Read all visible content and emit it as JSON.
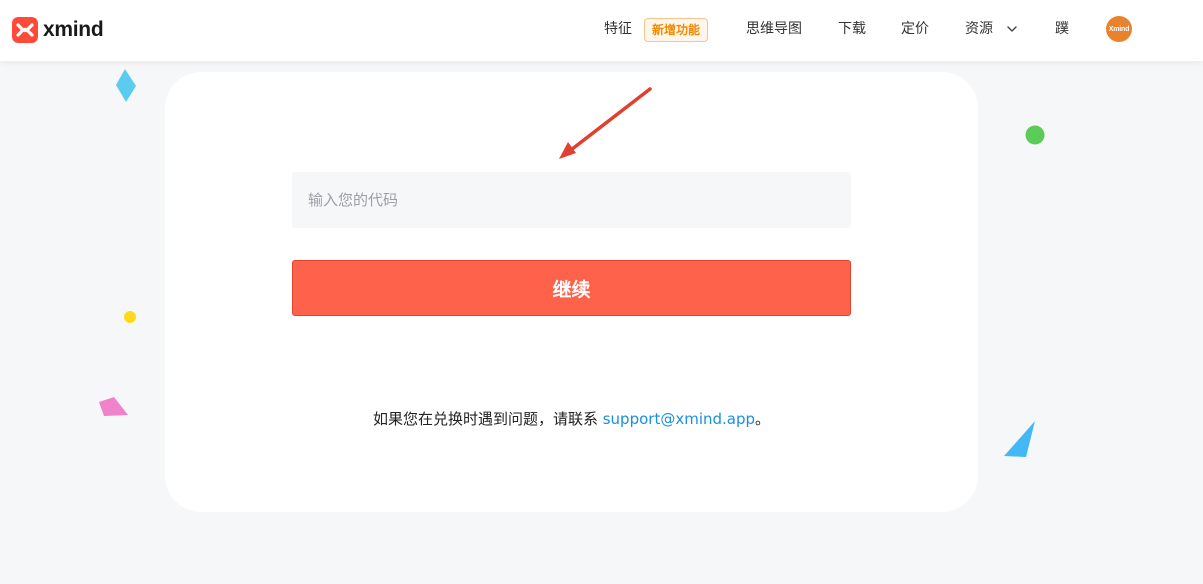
{
  "header": {
    "logo_text": "xmind",
    "nav": {
      "features": "特征",
      "new_badge": "新增功能",
      "mind_map": "思维导图",
      "download": "下载",
      "pricing": "定价",
      "resources": "资源",
      "extra": "蹼"
    },
    "avatar_text": "Xmind"
  },
  "form": {
    "code_placeholder": "输入您的代码",
    "code_value": "",
    "continue_label": "继续"
  },
  "help": {
    "text_prefix": "如果您在兑换时遇到问题，请联系 ",
    "email": "support@xmind.app",
    "text_suffix": "。"
  },
  "colors": {
    "brand": "#ff624a",
    "link": "#1a8fe0",
    "badge_text": "#f08a00",
    "annotation_arrow": "#e04030"
  },
  "icons": {
    "logo": "xmind-logo-icon",
    "resources_dropdown": "chevron-down-icon",
    "annotation": "red-arrow-icon"
  }
}
